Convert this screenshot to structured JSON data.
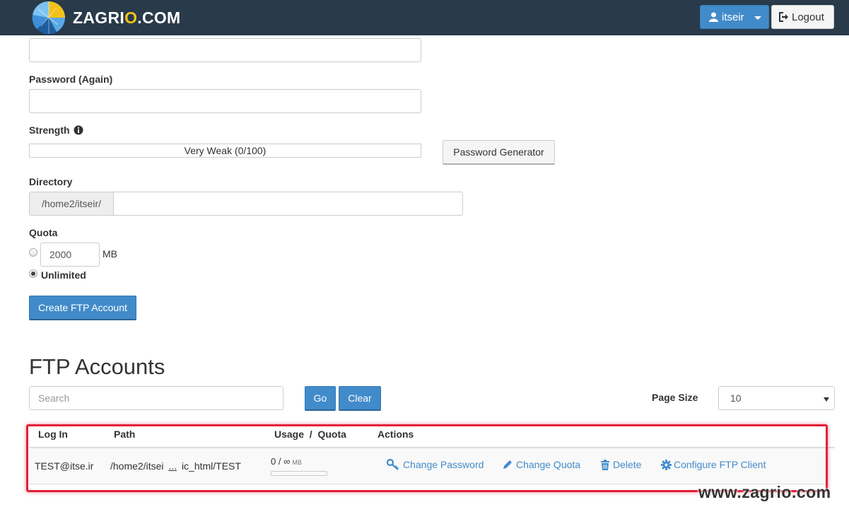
{
  "header": {
    "brand_prefix": "ZAGRI",
    "brand_o": "O",
    "brand_suffix": ".COM",
    "user_name": "itseir",
    "logout_label": "Logout"
  },
  "form": {
    "password_again_label": "Password (Again)",
    "strength_label": "Strength",
    "strength_text": "Very Weak (0/100)",
    "password_generator_label": "Password Generator",
    "directory_label": "Directory",
    "directory_prefix": "/home2/itseir/",
    "quota_label": "Quota",
    "quota_value": "2000",
    "quota_unit": "MB",
    "unlimited_label": "Unlimited",
    "quota_mode": "unlimited",
    "create_button_label": "Create FTP Account"
  },
  "accounts": {
    "title": "FTP Accounts",
    "search_placeholder": "Search",
    "go_label": "Go",
    "clear_label": "Clear",
    "page_size_label": "Page Size",
    "page_size_value": "10",
    "columns": {
      "login": "Log In",
      "path": "Path",
      "usage_quota": "Usage  /  Quota",
      "actions": "Actions"
    },
    "rows": [
      {
        "login": "TEST@itse.ir",
        "path_start": "/home2/itsei",
        "path_ellipsis": "...",
        "path_end": "ic_html/TEST",
        "usage": "0 / ∞",
        "usage_unit": "MB",
        "usage_fraction": 0,
        "actions": {
          "change_password": "Change Password",
          "change_quota": "Change Quota",
          "delete": "Delete",
          "configure": "Configure FTP Client"
        }
      }
    ]
  },
  "watermark": "www.zagrio.com",
  "colors": {
    "topbar": "#293a4a",
    "primary": "#428bca",
    "link": "#428bca",
    "highlight": "#e3203a",
    "brand_accent": "#f6c318"
  }
}
